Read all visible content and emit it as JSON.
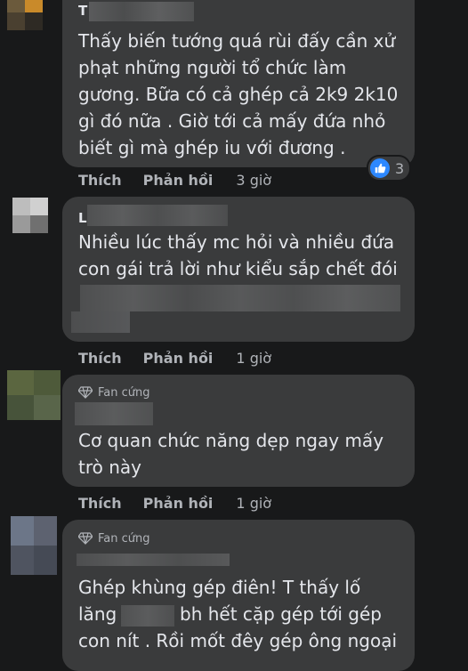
{
  "comments": [
    {
      "author": "T",
      "text_lines": [
        "Thấy biến tướng quá rùi đấy cần xử",
        "phạt những người tổ chức làm",
        "gương. Bữa có cả ghép cả 2k9 2k10",
        "gì đó nữa . Giờ tới cả mấy đứa nhỏ",
        "biết gì mà ghép iu với đương ."
      ],
      "like_label": "Thích",
      "reply_label": "Phản hồi",
      "time": "3 giờ",
      "reactions": {
        "icon": "thumbs-up-icon",
        "count": "3"
      }
    },
    {
      "author": "L",
      "text_lines": [
        "Nhiều lúc thấy mc hỏi và nhiều đứa",
        "con gái trả lời như kiểu sắp chết đói"
      ],
      "like_label": "Thích",
      "reply_label": "Phản hồi",
      "time": "1 giờ"
    },
    {
      "badge": "Fan cứng",
      "text_lines": [
        "Cơ quan chức năng dẹp ngay mấy",
        "trò này"
      ],
      "like_label": "Thích",
      "reply_label": "Phản hồi",
      "time": "1 giờ"
    },
    {
      "badge": "Fan cứng",
      "text_lines": [
        "Ghép khùng gép điên! T thấy lố",
        "lăng",
        "bh hết cặp gép tới gép",
        "con nít . Rồi mốt đêy gép ông ngoại"
      ]
    }
  ],
  "colors": {
    "background": "#18191a",
    "bubble": "#3a3b3c",
    "text": "#e4e6eb",
    "secondary_text": "#b0b3b8",
    "like_blue": "#2d88ff"
  }
}
